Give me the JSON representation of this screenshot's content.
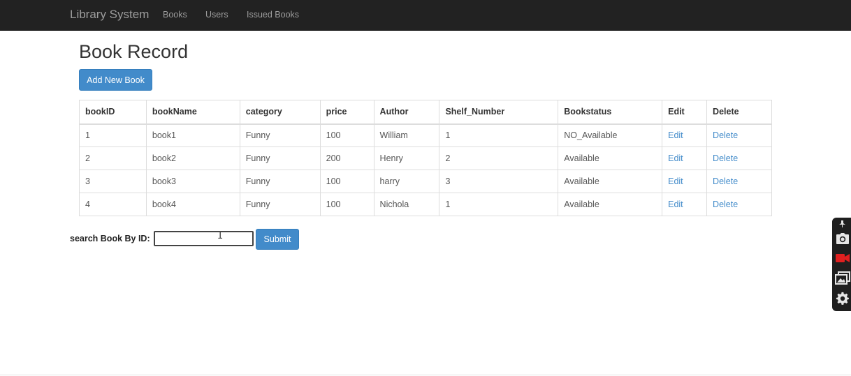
{
  "navbar": {
    "brand": "Library System",
    "links": [
      "Books",
      "Users",
      "Issued Books"
    ]
  },
  "page": {
    "title": "Book Record",
    "add_button": "Add New Book"
  },
  "table": {
    "headers": [
      "bookID",
      "bookName",
      "category",
      "price",
      "Author",
      "Shelf_Number",
      "Bookstatus",
      "Edit",
      "Delete"
    ],
    "rows": [
      [
        "1",
        "book1",
        "Funny",
        "100",
        "William",
        "1",
        "NO_Available",
        "Edit",
        "Delete"
      ],
      [
        "2",
        "book2",
        "Funny",
        "200",
        "Henry",
        "2",
        "Available",
        "Edit",
        "Delete"
      ],
      [
        "3",
        "book3",
        "Funny",
        "100",
        "harry",
        "3",
        "Available",
        "Edit",
        "Delete"
      ],
      [
        "4",
        "book4",
        "Funny",
        "100",
        "Nichola",
        "1",
        "Available",
        "Edit",
        "Delete"
      ]
    ]
  },
  "search": {
    "label": "search Book By ID:",
    "value": "",
    "submit_label": "Submit"
  },
  "toolbar": {
    "icons": [
      "pin-icon",
      "camera-icon",
      "video-record-icon",
      "gallery-icon",
      "gear-icon"
    ]
  },
  "colors": {
    "navbar": "#222222",
    "primary": "#428bca",
    "link": "#428bca",
    "record": "#e02020"
  }
}
